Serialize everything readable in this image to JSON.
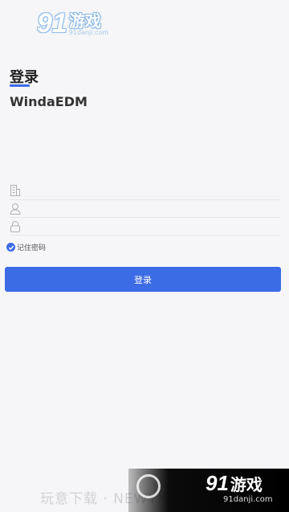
{
  "watermark_top": {
    "number": "91",
    "brand": "游戏",
    "url": "91danji.com"
  },
  "login": {
    "title": "登录",
    "app_name": "WindaEDM",
    "fields": [
      {
        "icon": "building-icon",
        "value": "",
        "placeholder": ""
      },
      {
        "icon": "user-icon",
        "value": "",
        "placeholder": ""
      },
      {
        "icon": "lock-icon",
        "value": "",
        "placeholder": ""
      }
    ],
    "remember_label": "记住密码",
    "remember_checked": true,
    "submit_label": "登录",
    "accent_color": "#3c6be6"
  },
  "watermark_bottom": {
    "text": "玩意下载 · NEWYXH.COM.CN",
    "number": "91",
    "brand": "游戏",
    "url": "91danji.com"
  }
}
